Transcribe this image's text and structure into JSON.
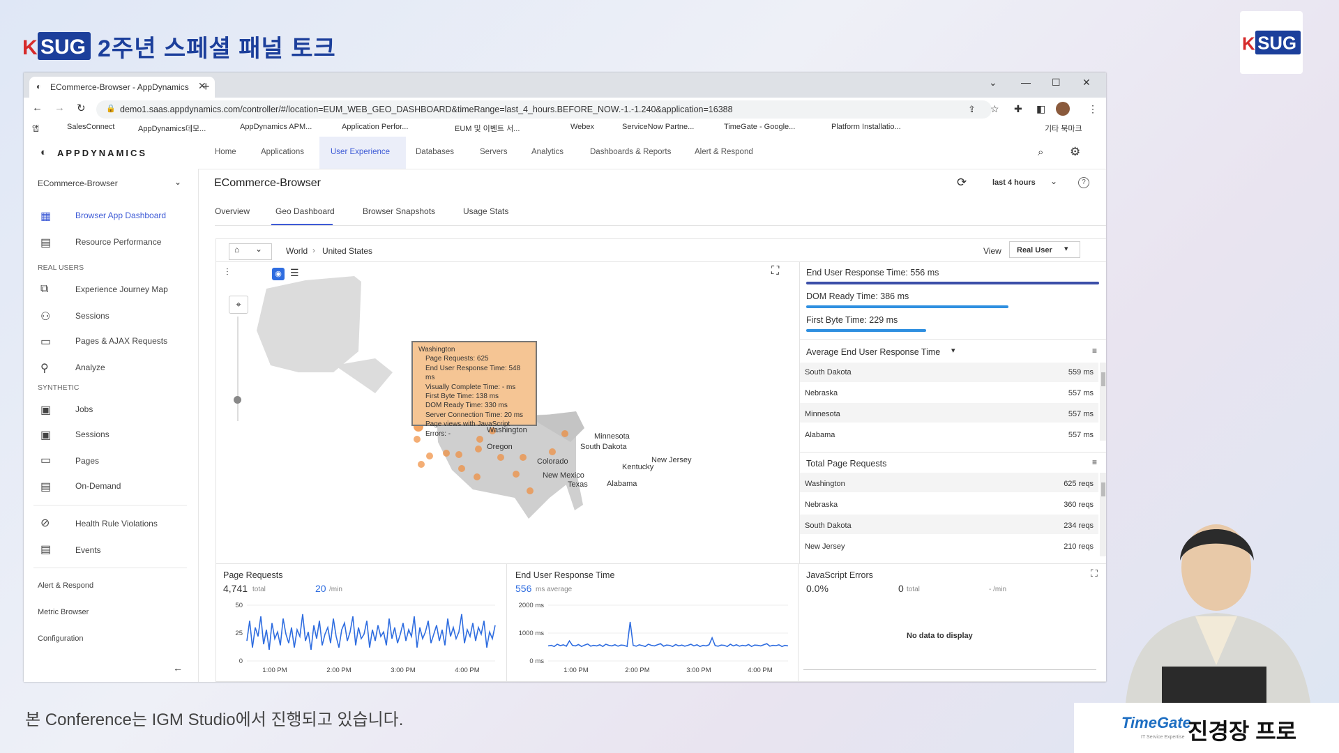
{
  "conference": {
    "logo_text": "KSUG",
    "title": "2주년 스페셜 패널 토크",
    "footer": "본 Conference는 IGM Studio에서 진행되고 있습니다.",
    "presenter_company": "TimeGate",
    "presenter_company_sub": "IT Service Expertise",
    "presenter_name": "진경장 프로"
  },
  "browser": {
    "tab_title": "ECommerce-Browser - AppDynamics",
    "url": "demo1.saas.appdynamics.com/controller/#/location=EUM_WEB_GEO_DASHBOARD&timeRange=last_4_hours.BEFORE_NOW.-1.-1.240&application=16388",
    "bookmarks": [
      "앱",
      "SalesConnect",
      "AppDynamics데모...",
      "AppDynamics APM...",
      "Application Perfor...",
      "EUM 및 이벤트 서...",
      "Webex",
      "ServiceNow Partne...",
      "TimeGate - Google...",
      "Platform Installatio...",
      "기타 북마크"
    ]
  },
  "app": {
    "logo": "APPDYNAMICS",
    "nav": [
      "Home",
      "Applications",
      "User Experience",
      "Databases",
      "Servers",
      "Analytics",
      "Dashboards & Reports",
      "Alert & Respond"
    ],
    "app_selector": "ECommerce-Browser",
    "page_title": "ECommerce-Browser",
    "time_range": "last 4 hours",
    "tabs": [
      "Overview",
      "Geo Dashboard",
      "Browser Snapshots",
      "Usage Stats"
    ]
  },
  "sidebar": {
    "top_items": [
      "Browser App Dashboard",
      "Resource Performance"
    ],
    "real_users_label": "REAL USERS",
    "real_users_items": [
      "Experience Journey Map",
      "Sessions",
      "Pages & AJAX Requests",
      "Analyze"
    ],
    "synthetic_label": "SYNTHETIC",
    "synthetic_items": [
      "Jobs",
      "Sessions",
      "Pages",
      "On-Demand"
    ],
    "other_items": [
      "Health Rule Violations",
      "Events"
    ],
    "footer_items": [
      "Alert & Respond",
      "Metric Browser",
      "Configuration"
    ]
  },
  "geo": {
    "breadcrumb": [
      "World",
      "United States"
    ],
    "view_label": "View",
    "view_value": "Real User",
    "states": [
      "Washington",
      "Oregon",
      "Minnesota",
      "South Dakota",
      "Colorado",
      "Kentucky",
      "New Jersey",
      "New Mexico",
      "Texas",
      "Alabama"
    ],
    "tooltip": {
      "title": "Washington",
      "lines": [
        "Page Requests: 625",
        "End User Response Time: 548 ms",
        "Visually Complete Time: - ms",
        "First Byte Time: 138 ms",
        "DOM Ready Time: 330 ms",
        "Server Connection Time: 20 ms",
        "Page views with JavaScript Errors: -"
      ]
    }
  },
  "metrics": {
    "eurt": {
      "label": "End User Response Time: 556 ms",
      "fraction": 1.0,
      "color": "#3c4fa8"
    },
    "dom": {
      "label": "DOM Ready Time: 386 ms",
      "fraction": 0.69,
      "color": "#2f8fe0"
    },
    "fbt": {
      "label": "First Byte Time: 229 ms",
      "fraction": 0.41,
      "color": "#2f8fe0"
    }
  },
  "avg_table": {
    "title": "Average End User Response Time",
    "rows": [
      {
        "name": "South Dakota",
        "value": "559 ms"
      },
      {
        "name": "Nebraska",
        "value": "557 ms"
      },
      {
        "name": "Minnesota",
        "value": "557 ms"
      },
      {
        "name": "Alabama",
        "value": "557 ms"
      }
    ]
  },
  "req_table": {
    "title": "Total Page Requests",
    "rows": [
      {
        "name": "Washington",
        "value": "625 reqs"
      },
      {
        "name": "Nebraska",
        "value": "360 reqs"
      },
      {
        "name": "South Dakota",
        "value": "234 reqs"
      },
      {
        "name": "New Jersey",
        "value": "210 reqs"
      }
    ]
  },
  "bottom": {
    "page_requests": {
      "title": "Page Requests",
      "total": "4,741",
      "total_unit": "total",
      "rate": "20",
      "rate_unit": "/min"
    },
    "eurt": {
      "title": "End User Response Time",
      "avg": "556",
      "avg_unit": "ms average"
    },
    "js": {
      "title": "JavaScript Errors",
      "pct": "0.0%",
      "total": "0",
      "total_unit": "total",
      "rate": "- /min",
      "empty": "No data to display"
    }
  },
  "chart_data": [
    {
      "type": "line",
      "title": "Page Requests",
      "x_ticks": [
        "1:00 PM",
        "2:00 PM",
        "3:00 PM",
        "4:00 PM"
      ],
      "y_ticks": [
        "50",
        "25",
        "0"
      ],
      "ylim": [
        0,
        50
      ],
      "series": [
        {
          "values": [
            18,
            36,
            12,
            30,
            22,
            40,
            15,
            28,
            10,
            34,
            20,
            26,
            14,
            38,
            24,
            16,
            30,
            12,
            28,
            22,
            42,
            18,
            26,
            10,
            32,
            20,
            36,
            14,
            24,
            30,
            16,
            38,
            22,
            12,
            28,
            34,
            18,
            26,
            40,
            14,
            30,
            20,
            24,
            36,
            12,
            28,
            18,
            32,
            22,
            26,
            14,
            38,
            20,
            30,
            16,
            24,
            34,
            18,
            28,
            22,
            40,
            12,
            30,
            20,
            26,
            36,
            16,
            24,
            32,
            18,
            28,
            14,
            38,
            22,
            30,
            20,
            26,
            42,
            16,
            28,
            22,
            34,
            18,
            30,
            24,
            36,
            12,
            26,
            20,
            32
          ]
        }
      ]
    },
    {
      "type": "line",
      "title": "End User Response Time",
      "x_ticks": [
        "1:00 PM",
        "2:00 PM",
        "3:00 PM",
        "4:00 PM"
      ],
      "y_ticks": [
        "2000 ms",
        "1000 ms",
        "0 ms"
      ],
      "ylim": [
        0,
        2000
      ],
      "series": [
        {
          "values": [
            540,
            560,
            520,
            600,
            550,
            580,
            530,
            720,
            560,
            540,
            590,
            520,
            570,
            610,
            530,
            560,
            540,
            580,
            520,
            600,
            560,
            540,
            580,
            530,
            570,
            560,
            520,
            1400,
            560,
            530,
            580,
            550,
            520,
            600,
            560,
            540,
            580,
            620,
            530,
            570,
            560,
            520,
            590,
            540,
            570,
            530,
            560,
            600,
            540,
            580,
            520,
            560,
            540,
            580,
            830,
            550,
            530,
            570,
            560,
            520,
            600,
            540,
            580,
            530,
            560,
            540,
            590,
            520,
            570,
            560,
            540,
            580,
            620,
            530,
            560,
            550,
            580,
            520,
            560,
            540
          ]
        }
      ]
    }
  ]
}
